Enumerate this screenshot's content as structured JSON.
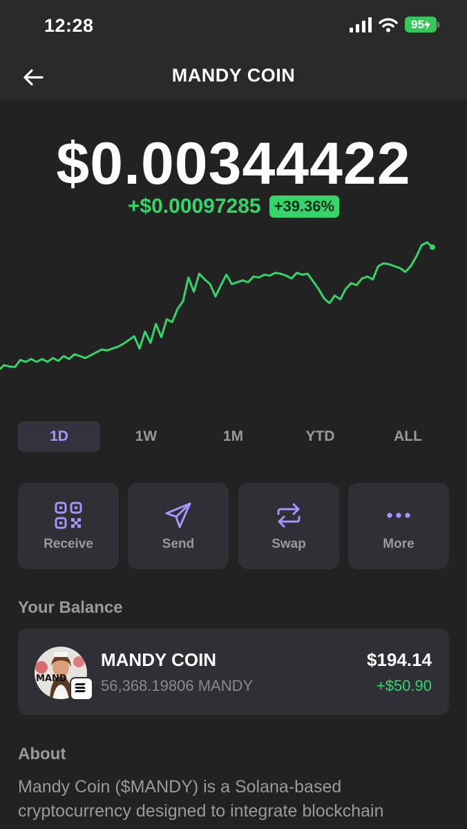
{
  "status_bar": {
    "time": "12:28",
    "battery": "95"
  },
  "header": {
    "title": "MANDY COIN",
    "back_icon": "arrow-left-icon"
  },
  "price": {
    "value": "$0.00344422",
    "change_abs": "+$0.00097285",
    "change_pct": "+39.36%",
    "positive_color": "#34d66a"
  },
  "chart_data": {
    "type": "line",
    "title": "",
    "xlabel": "",
    "ylabel": "",
    "series": [
      {
        "color": "#34d66a",
        "values": [
          0.00247,
          0.002525,
          0.00251,
          0.002505,
          0.00258,
          0.00256,
          0.00259,
          0.00256,
          0.00259,
          0.00256,
          0.0026,
          0.00257,
          0.00262,
          0.00259,
          0.00264,
          0.00262,
          0.0026,
          0.00263,
          0.00266,
          0.00269,
          0.00268,
          0.0027,
          0.00272,
          0.00275,
          0.00279,
          0.00283,
          0.0027,
          0.00288,
          0.00276,
          0.00296,
          0.00282,
          0.00301,
          0.00298,
          0.00312,
          0.0032,
          0.00345,
          0.0033,
          0.00349,
          0.00343,
          0.00338,
          0.00325,
          0.00337,
          0.00348,
          0.00338,
          0.0034,
          0.00342,
          0.0034,
          0.00346,
          0.00345,
          0.00348,
          0.00347,
          0.0035,
          0.00349,
          0.00347,
          0.00344,
          0.0035,
          0.00348,
          0.00349,
          0.00341,
          0.00333,
          0.00323,
          0.00318,
          0.00326,
          0.00322,
          0.00333,
          0.00339,
          0.00337,
          0.00344,
          0.00346,
          0.00343,
          0.00357,
          0.0036,
          0.00359,
          0.00357,
          0.00355,
          0.00351,
          0.00357,
          0.00367,
          0.00379,
          0.003822,
          0.00377
        ]
      }
    ],
    "grid": false,
    "legend": "none"
  },
  "ranges": [
    "1D",
    "1W",
    "1M",
    "YTD",
    "ALL"
  ],
  "selected_range": "1D",
  "actions": [
    {
      "label": "Receive",
      "icon": "qr-code-icon"
    },
    {
      "label": "Send",
      "icon": "paper-plane-icon"
    },
    {
      "label": "Swap",
      "icon": "swap-arrows-icon"
    },
    {
      "label": "More",
      "icon": "more-dots-icon"
    }
  ],
  "accent_color": "#a596ff",
  "balance": {
    "section_title": "Your Balance",
    "name": "MANDY COIN",
    "amount": "56,368.19806 MANDY",
    "value": "$194.14",
    "change": "+$50.90"
  },
  "about": {
    "section_title": "About",
    "text": "Mandy Coin ($MANDY) is a Solana-based cryptocurrency designed to integrate blockchain"
  }
}
